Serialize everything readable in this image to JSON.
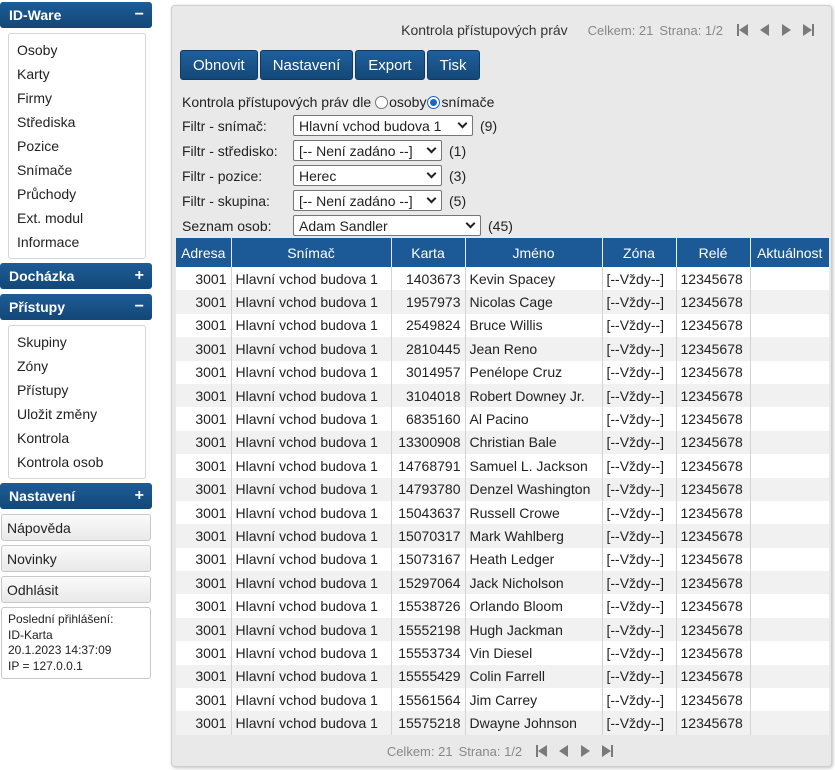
{
  "sidebar": {
    "idware": {
      "title": "ID-Ware",
      "toggle": "−",
      "items": [
        "Osoby",
        "Karty",
        "Firmy",
        "Střediska",
        "Pozice",
        "Snímače",
        "Průchody",
        "Ext. modul",
        "Informace"
      ]
    },
    "dochazka": {
      "title": "Docházka",
      "toggle": "+"
    },
    "pristupy": {
      "title": "Přístupy",
      "toggle": "−",
      "items": [
        "Skupiny",
        "Zóny",
        "Přístupy",
        "Uložit změny",
        "Kontrola",
        "Kontrola osob"
      ]
    },
    "nastaveni": {
      "title": "Nastavení",
      "toggle": "+"
    },
    "napoveda": "Nápověda",
    "novinky": "Novinky",
    "odhlasit": "Odhlásit",
    "login": {
      "line1": "Poslední přihlášení:",
      "line2": "ID-Karta",
      "line3": "20.1.2023 14:37:09",
      "line4": "IP = 127.0.0.1"
    }
  },
  "main": {
    "title": "Kontrola přístupových práv",
    "pager": {
      "total": "Celkem: 21",
      "page": "Strana: 1/2"
    },
    "toolbar": {
      "refresh": "Obnovit",
      "settings": "Nastavení",
      "export": "Export",
      "print": "Tisk"
    },
    "form": {
      "mode_label": "Kontrola přístupových práv dle",
      "mode_persons": "osoby",
      "mode_readers": "snímače",
      "filters": [
        {
          "label": "Filtr - snímač:",
          "value": "Hlavní vchod budova 1",
          "count": "(9)"
        },
        {
          "label": "Filtr - středisko:",
          "value": "[-- Není zadáno --]",
          "count": "(1)"
        },
        {
          "label": "Filtr - pozice:",
          "value": "Herec",
          "count": "(3)"
        },
        {
          "label": "Filtr - skupina:",
          "value": "[-- Není zadáno --]",
          "count": "(5)"
        },
        {
          "label": "Seznam osob:",
          "value": "Adam Sandler",
          "count": "(45)"
        }
      ]
    },
    "table": {
      "headers": [
        "Adresa",
        "Snímač",
        "Karta",
        "Jméno",
        "Zóna",
        "Relé",
        "Aktuálnost"
      ],
      "rows": [
        [
          "3001",
          "Hlavní vchod budova 1",
          "1403673",
          "Kevin Spacey",
          "[--Vždy--]",
          "12345678",
          ""
        ],
        [
          "3001",
          "Hlavní vchod budova 1",
          "1957973",
          "Nicolas Cage",
          "[--Vždy--]",
          "12345678",
          ""
        ],
        [
          "3001",
          "Hlavní vchod budova 1",
          "2549824",
          "Bruce Willis",
          "[--Vždy--]",
          "12345678",
          ""
        ],
        [
          "3001",
          "Hlavní vchod budova 1",
          "2810445",
          "Jean Reno",
          "[--Vždy--]",
          "12345678",
          ""
        ],
        [
          "3001",
          "Hlavní vchod budova 1",
          "3014957",
          "Penélope Cruz",
          "[--Vždy--]",
          "12345678",
          ""
        ],
        [
          "3001",
          "Hlavní vchod budova 1",
          "3104018",
          "Robert Downey Jr.",
          "[--Vždy--]",
          "12345678",
          ""
        ],
        [
          "3001",
          "Hlavní vchod budova 1",
          "6835160",
          "Al Pacino",
          "[--Vždy--]",
          "12345678",
          ""
        ],
        [
          "3001",
          "Hlavní vchod budova 1",
          "13300908",
          "Christian Bale",
          "[--Vždy--]",
          "12345678",
          ""
        ],
        [
          "3001",
          "Hlavní vchod budova 1",
          "14768791",
          "Samuel L. Jackson",
          "[--Vždy--]",
          "12345678",
          ""
        ],
        [
          "3001",
          "Hlavní vchod budova 1",
          "14793780",
          "Denzel Washington",
          "[--Vždy--]",
          "12345678",
          ""
        ],
        [
          "3001",
          "Hlavní vchod budova 1",
          "15043637",
          "Russell Crowe",
          "[--Vždy--]",
          "12345678",
          ""
        ],
        [
          "3001",
          "Hlavní vchod budova 1",
          "15070317",
          "Mark Wahlberg",
          "[--Vždy--]",
          "12345678",
          ""
        ],
        [
          "3001",
          "Hlavní vchod budova 1",
          "15073167",
          "Heath Ledger",
          "[--Vždy--]",
          "12345678",
          ""
        ],
        [
          "3001",
          "Hlavní vchod budova 1",
          "15297064",
          "Jack Nicholson",
          "[--Vždy--]",
          "12345678",
          ""
        ],
        [
          "3001",
          "Hlavní vchod budova 1",
          "15538726",
          "Orlando Bloom",
          "[--Vždy--]",
          "12345678",
          ""
        ],
        [
          "3001",
          "Hlavní vchod budova 1",
          "15552198",
          "Hugh Jackman",
          "[--Vždy--]",
          "12345678",
          ""
        ],
        [
          "3001",
          "Hlavní vchod budova 1",
          "15553734",
          "Vin Diesel",
          "[--Vždy--]",
          "12345678",
          ""
        ],
        [
          "3001",
          "Hlavní vchod budova 1",
          "15555429",
          "Colin Farrell",
          "[--Vždy--]",
          "12345678",
          ""
        ],
        [
          "3001",
          "Hlavní vchod budova 1",
          "15561564",
          "Jim Carrey",
          "[--Vždy--]",
          "12345678",
          ""
        ],
        [
          "3001",
          "Hlavní vchod budova 1",
          "15575218",
          "Dwayne Johnson",
          "[--Vždy--]",
          "12345678",
          ""
        ]
      ]
    }
  },
  "colors": {
    "accent": "#1b5a96",
    "panel_bg": "#e9e9e9",
    "row_alt": "#f1f1f1"
  },
  "icons": {
    "pager_first": "first-page-icon",
    "pager_prev": "prev-page-icon",
    "pager_next": "next-page-icon",
    "pager_last": "last-page-icon"
  }
}
